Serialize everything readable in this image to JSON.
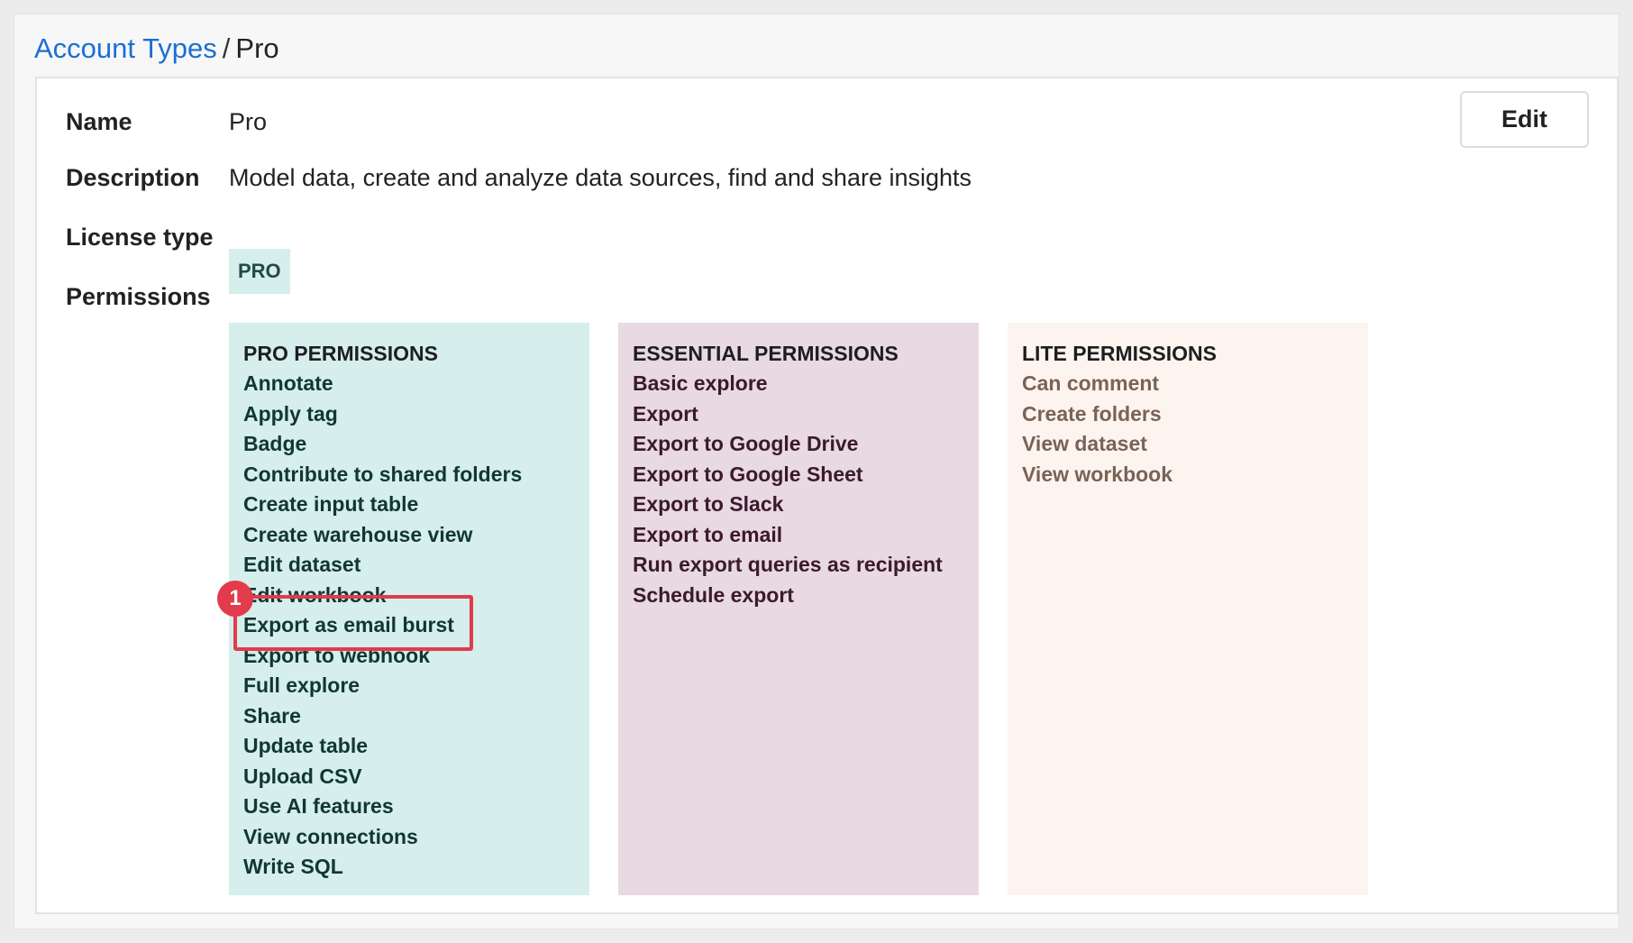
{
  "breadcrumb": {
    "parent": "Account Types",
    "separator": "/",
    "current": "Pro"
  },
  "actions": {
    "edit_label": "Edit"
  },
  "fields": {
    "name_label": "Name",
    "name_value": "Pro",
    "description_label": "Description",
    "description_value": "Model data, create and analyze data sources, find and share insights",
    "license_label": "License type",
    "license_value": "PRO",
    "permissions_label": "Permissions"
  },
  "permissions": {
    "pro": {
      "title": "PRO PERMISSIONS",
      "items": [
        "Annotate",
        "Apply tag",
        "Badge",
        "Contribute to shared folders",
        "Create input table",
        "Create warehouse view",
        "Edit dataset",
        "Edit workbook",
        "Export as email burst",
        "Export to webhook",
        "Full explore",
        "Share",
        "Update table",
        "Upload CSV",
        "Use AI features",
        "View connections",
        "Write SQL"
      ]
    },
    "essential": {
      "title": "ESSENTIAL PERMISSIONS",
      "items": [
        "Basic explore",
        "Export",
        "Export to Google Drive",
        "Export to Google Sheet",
        "Export to Slack",
        "Export to email",
        "Run export queries as recipient",
        "Schedule export"
      ]
    },
    "lite": {
      "title": "LITE PERMISSIONS",
      "items": [
        "Can comment",
        "Create folders",
        "View dataset",
        "View workbook"
      ]
    }
  },
  "annotation": {
    "callout_number": "1",
    "highlighted_item": "Export as email burst",
    "color": "#e23b4b"
  },
  "colors": {
    "link": "#1a6fd4",
    "pro_bg": "#d6eeec",
    "essential_bg": "#e8d9e2",
    "lite_bg": "#fdf4ef"
  }
}
